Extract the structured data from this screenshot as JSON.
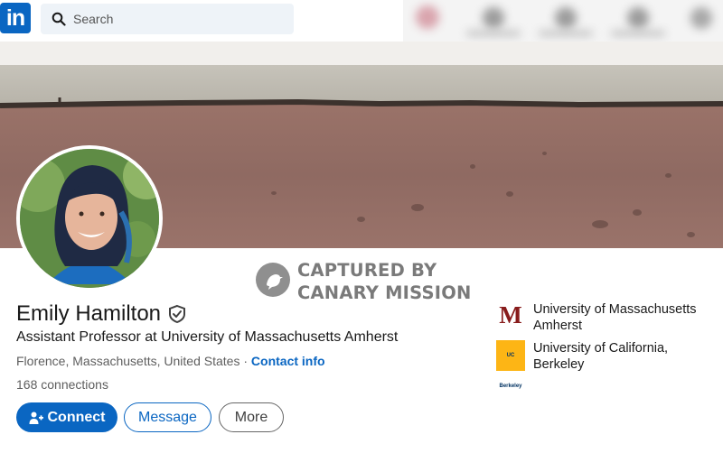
{
  "nav": {
    "logo_text": "in",
    "search_placeholder": "Search"
  },
  "watermark": {
    "line1": "CAPTURED BY",
    "line2": "CANARY MISSION"
  },
  "profile": {
    "name": "Emily Hamilton",
    "headline": "Assistant Professor at University of Massachusetts Amherst",
    "location": "Florence, Massachusetts, United States",
    "separator": " · ",
    "contact_info_label": "Contact info",
    "connections": "168 connections"
  },
  "actions": {
    "connect_label": "Connect",
    "message_label": "Message",
    "more_label": "More"
  },
  "education": [
    {
      "name": "University of Massachusetts Amherst",
      "logo_text": "M",
      "logo_icon": "umass-logo"
    },
    {
      "name": "University of California, Berkeley",
      "logo_text": "UC Berkeley",
      "logo_icon": "ucb-logo"
    }
  ],
  "colors": {
    "brand": "#0a66c2",
    "umass": "#881c1c",
    "ucb_gold": "#fdb515",
    "ucb_blue": "#003262"
  }
}
